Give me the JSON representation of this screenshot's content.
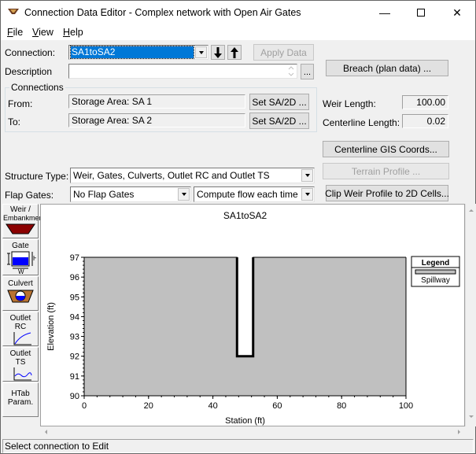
{
  "window": {
    "title": "Connection Data Editor - Complex network with Open Air Gates",
    "minimize_glyph": "—",
    "maximize_glyph": "☐",
    "close_glyph": "✕"
  },
  "menu": {
    "file": "File",
    "view": "View",
    "help": "Help"
  },
  "form": {
    "connection_label": "Connection:",
    "connection_value": "SA1toSA2",
    "down_arrow_glyph": "🠗",
    "up_arrow_glyph": "🠕",
    "apply_data": "Apply Data",
    "description_label": "Description",
    "description_value": "",
    "ellipsis": "...",
    "breach_button": "Breach (plan data) ...",
    "connections_group": "Connections",
    "from_label": "From:",
    "from_value": "Storage Area: SA 1",
    "to_label": "To:",
    "to_value": "Storage Area: SA 2",
    "set_sa_from": "Set SA/2D ...",
    "set_sa_to": "Set SA/2D ...",
    "weir_length_label": "Weir Length:",
    "weir_length_value": "100.00",
    "centerline_length_label": "Centerline Length:",
    "centerline_length_value": "0.02",
    "centerline_gis_button": "Centerline GIS Coords...",
    "structure_type_label": "Structure Type:",
    "structure_type_value": "Weir, Gates, Culverts, Outlet RC and Outlet TS",
    "terrain_profile_button": "Terrain Profile ...",
    "flap_gates_label": "Flap Gates:",
    "flap_gates_value": "No Flap Gates",
    "compute_flow_value": "Compute flow each time ste",
    "clip_weir_button": "Clip Weir Profile to 2D Cells..."
  },
  "sidebar": {
    "weir": [
      "Weir /",
      "Embankment"
    ],
    "gate": "Gate",
    "gate_h": "H",
    "gate_w": "W",
    "culvert": "Culvert",
    "outlet_rc": [
      "Outlet",
      "RC"
    ],
    "outlet_ts": [
      "Outlet",
      "TS"
    ],
    "htab": [
      "HTab",
      "Param."
    ]
  },
  "chart_data": {
    "type": "area",
    "title": "SA1toSA2",
    "xlabel": "Station (ft)",
    "ylabel": "Elevation (ft)",
    "xlim": [
      0,
      100
    ],
    "ylim": [
      90,
      97
    ],
    "xticks": [
      0,
      20,
      40,
      60,
      80,
      100
    ],
    "yticks": [
      90,
      91,
      92,
      93,
      94,
      95,
      96,
      97
    ],
    "series": [
      {
        "name": "Spillway",
        "fill": "#c0c0c0",
        "profile": [
          {
            "x": 0,
            "y": 97
          },
          {
            "x": 47.5,
            "y": 97
          },
          {
            "x": 47.5,
            "y": 92
          },
          {
            "x": 52.5,
            "y": 92
          },
          {
            "x": 52.5,
            "y": 97
          },
          {
            "x": 100,
            "y": 97
          }
        ]
      }
    ],
    "legend": {
      "title": "Legend",
      "placement": "right",
      "entries": [
        "Spillway"
      ]
    },
    "grid": false
  },
  "status": {
    "text": "Select connection to Edit"
  }
}
